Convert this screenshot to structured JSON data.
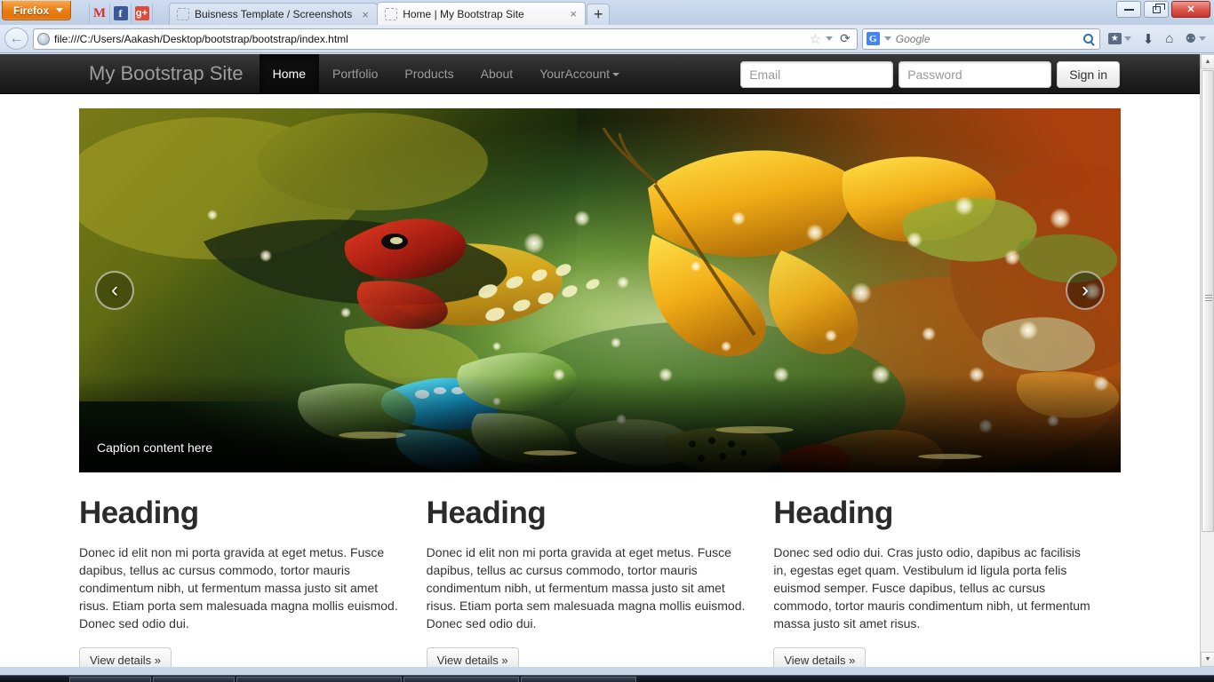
{
  "browser": {
    "firefox_button": "Firefox",
    "app_icons": [
      {
        "name": "gmail-icon",
        "glyph": "M"
      },
      {
        "name": "facebook-icon",
        "glyph": "f"
      },
      {
        "name": "googleplus-icon",
        "glyph": "g+"
      }
    ],
    "tabs": [
      {
        "title": "Buisness Template / Screenshots",
        "active": false,
        "close": "×"
      },
      {
        "title": "Home | My Bootstrap Site",
        "active": true,
        "close": "×"
      }
    ],
    "newtab_label": "+",
    "window_buttons": {
      "minimize": "minimize",
      "restore": "restore",
      "close": "✕"
    },
    "back_glyph": "←",
    "url": "file:///C:/Users/Aakash/Desktop/bootstrap/bootstrap/index.html",
    "star_glyph": "☆",
    "reload_glyph": "⟳",
    "search_engine": "G",
    "search_placeholder": "Google",
    "toolbar_icons": [
      "bookmarks-icon",
      "downloads-icon",
      "home-icon",
      "extension-icon"
    ]
  },
  "site": {
    "brand": "My Bootstrap Site",
    "nav": [
      {
        "label": "Home",
        "active": true,
        "caret": false
      },
      {
        "label": "Portfolio",
        "active": false,
        "caret": false
      },
      {
        "label": "Products",
        "active": false,
        "caret": false
      },
      {
        "label": "About",
        "active": false,
        "caret": false
      },
      {
        "label": "YourAccount",
        "active": false,
        "caret": true
      }
    ],
    "login": {
      "email_placeholder": "Email",
      "email_value": "",
      "password_placeholder": "Password",
      "password_value": "",
      "signin_label": "Sign in"
    },
    "carousel": {
      "caption": "Caption content here",
      "prev_glyph": "‹",
      "next_glyph": "›",
      "image_description": "butterflies over green water with bokeh lights"
    },
    "columns": [
      {
        "heading": "Heading",
        "body": "Donec id elit non mi porta gravida at eget metus. Fusce dapibus, tellus ac cursus commodo, tortor mauris condimentum nibh, ut fermentum massa justo sit amet risus. Etiam porta sem malesuada magna mollis euismod. Donec sed odio dui.",
        "button": "View details »"
      },
      {
        "heading": "Heading",
        "body": "Donec id elit non mi porta gravida at eget metus. Fusce dapibus, tellus ac cursus commodo, tortor mauris condimentum nibh, ut fermentum massa justo sit amet risus. Etiam porta sem malesuada magna mollis euismod. Donec sed odio dui.",
        "button": "View details »"
      },
      {
        "heading": "Heading",
        "body": "Donec sed odio dui. Cras justo odio, dapibus ac facilisis in, egestas eget quam. Vestibulum id ligula porta felis euismod semper. Fusce dapibus, tellus ac cursus commodo, tortor mauris condimentum nibh, ut fermentum massa justo sit amet risus.",
        "button": "View details »"
      }
    ]
  },
  "scrollbar": {
    "up_glyph": "▲",
    "down_glyph": "▼"
  },
  "colors": {
    "firefox_orange": "#e87b12",
    "navbar_dark": "#222222",
    "nav_link": "#9d9d9d",
    "page_bg": "#ffffff"
  }
}
